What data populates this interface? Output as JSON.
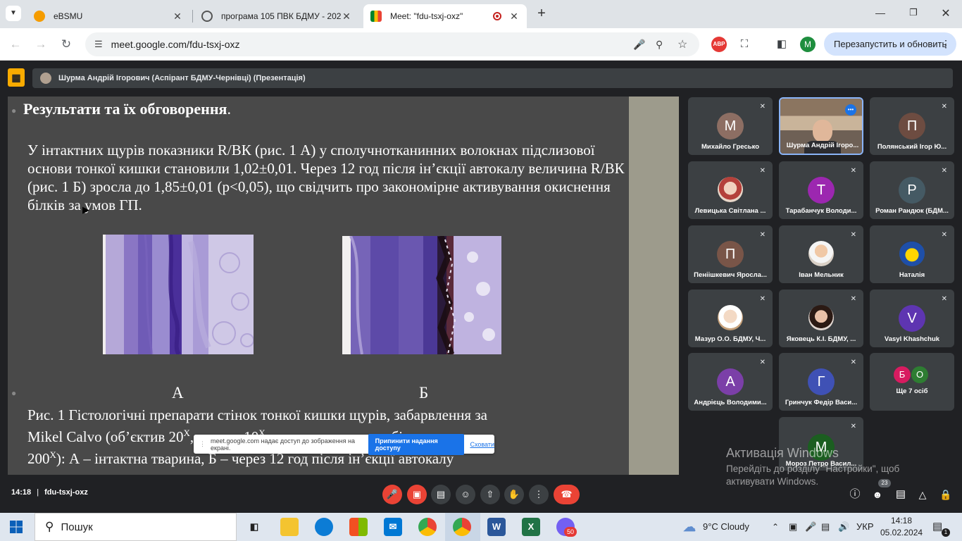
{
  "browser": {
    "tabs": [
      {
        "title": "eBSMU",
        "icon": "ebsmu-favicon"
      },
      {
        "title": "програма 105 ПВК БДМУ - 202",
        "icon": "globe-favicon"
      },
      {
        "title": "Meet: \"fdu-tsxj-oxz\"",
        "icon": "meet-favicon",
        "active": true
      }
    ],
    "url": "meet.google.com/fdu-tsxj-oxz",
    "profile_initial": "M",
    "abp_label": "ABP",
    "relaunch_label": "Перезапустить и обновить"
  },
  "meet": {
    "presenter_chip": "Шурма Андрій Ігорович (Аспірант БДМУ-Чернівці) (Презентація)",
    "time": "14:18",
    "separator": "|",
    "code": "fdu-tsxj-oxz",
    "participants_badge": "23",
    "share_notice": {
      "text": "meet.google.com надає доступ до зображення на екрані.",
      "stop_label": "Припинити надання доступу",
      "hide_label": "Сховати"
    }
  },
  "slide": {
    "title": "Результати та їх обговорення",
    "title_dot": ".",
    "paragraph": "У інтактних щурів показники R/ВК (рис. 1 А) у сполучнотканинних волокнах підслизової основи тонкої кишки становили 1,02±0,01. Через 12 год після ін’єкції автокалу величина R/ВК (рис. 1 Б) зросла до 1,85±0,01 (р<0,05), що свідчить про закономірне активування окиснення білків за умов ГП.",
    "label_a": "А",
    "label_b": "Б",
    "caption_line1": "Рис. 1 Гістологічні препарати стінок тонкої кишки щурів, забарвлення за",
    "caption_line2": "Mikel Calvo (об’єктив 20",
    "caption_line2_sup": "Х",
    "caption_line2_b": ", окуляр 10",
    "caption_line2_sup2": "Х",
    "caption_line2_c": ", загальне оптичне збільшення",
    "caption_line3": "200",
    "caption_line3_sup": "Х",
    "caption_line3_b": "): А – інтактна тварина, Б – через 12 год після ін’єкції автокалу"
  },
  "participants": [
    {
      "name": "Михайло Гресько",
      "initial": "М",
      "color": "#8d6e63",
      "muted": true
    },
    {
      "name": "Шурма Андрій Ігоро...",
      "initial": "",
      "color": "",
      "speaking": true,
      "video": true
    },
    {
      "name": "Полянський Ігор Ю...",
      "initial": "П",
      "color": "#6d4c41",
      "muted": true
    },
    {
      "name": "Левицька Світлана ...",
      "initial": "",
      "color": "#c9806f",
      "muted": true,
      "photo": true
    },
    {
      "name": "Тарабанчук Володи...",
      "initial": "Т",
      "color": "#9c27b0",
      "muted": true
    },
    {
      "name": "Роман Рандюк (БДМ...",
      "initial": "Р",
      "color": "#455a64",
      "muted": true
    },
    {
      "name": "Пеніішкевич Ярослa...",
      "initial": "П",
      "color": "#795548",
      "muted": true
    },
    {
      "name": "Іван Мельник",
      "initial": "",
      "color": "#d9c3b0",
      "muted": true,
      "photo": true
    },
    {
      "name": "Наталія",
      "initial": "",
      "color": "#3d6fb8",
      "muted": true,
      "photo": true
    },
    {
      "name": "Мазур О.О. БДМУ, Ч...",
      "initial": "",
      "color": "#e0c8a8",
      "muted": true,
      "photo": true
    },
    {
      "name": "Яковець К.І. БДМУ, ...",
      "initial": "",
      "color": "#7a5a50",
      "muted": true,
      "photo": true
    },
    {
      "name": "Vasyl Khashchuk",
      "initial": "V",
      "color": "#5e35b1",
      "muted": true
    },
    {
      "name": "Андрієць Володими...",
      "initial": "А",
      "color": "#7b3fa8",
      "muted": true
    },
    {
      "name": "Гринчук Федір Васи...",
      "initial": "Г",
      "color": "#3f51b5",
      "muted": true
    },
    {
      "name": "Ще 7 осіб",
      "initial": "",
      "color": "",
      "more": true,
      "initials": [
        "Б",
        "О"
      ],
      "initial_colors": [
        "#d81b60",
        "#2e7d32"
      ]
    },
    {
      "name": "Мороз Петро Васил...",
      "initial": "М",
      "color": "#1b5e20",
      "muted": true
    }
  ],
  "watermark": {
    "title": "Активація Windows",
    "line1": "Перейдіть до розділу \"Настройки\", щоб",
    "line2": "активувати Windows."
  },
  "taskbar": {
    "search_placeholder": "Пошук",
    "weather": "9°C  Cloudy",
    "lang": "УКР",
    "time": "14:18",
    "date": "05.02.2024",
    "viber_badge": "50",
    "notif_badge": "1"
  }
}
